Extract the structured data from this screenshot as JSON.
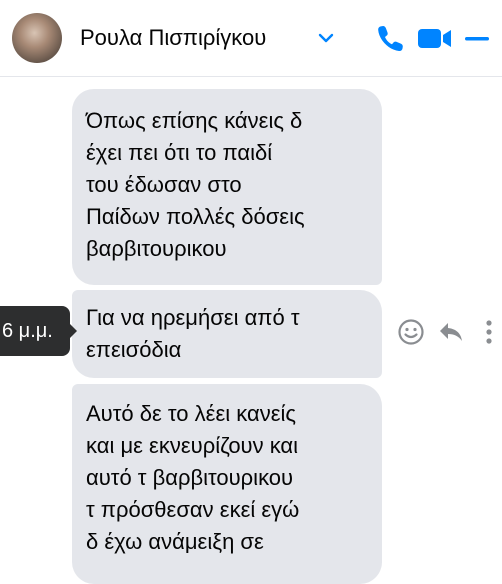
{
  "header": {
    "contact_name": "Ρουλα Πισπιρίγκου"
  },
  "messages": [
    {
      "lines": [
        "Όπως επίσης κάνεις δ",
        "έχει πει ότι το παιδί",
        "του έδωσαν στο",
        "Παίδων πολλές δόσεις",
        "βαρβιτουρικου"
      ]
    },
    {
      "lines": [
        "Για να ηρεμήσει από τ",
        "επεισόδια"
      ]
    },
    {
      "lines": [
        "Αυτό δε το λέει κανείς",
        "και με εκνευρίζουν και",
        "αυτό τ βαρβιτουρικου",
        "τ πρόσθεσαν εκεί εγώ",
        "δ έχω ανάμειξη σε"
      ]
    }
  ],
  "tooltip_time": "6 μ.μ.",
  "icons": {
    "accent": "#0084ff",
    "action_gray": "#8a8d91",
    "bubble_bg": "#e4e6eb",
    "tooltip_bg": "#2d2e2f"
  }
}
